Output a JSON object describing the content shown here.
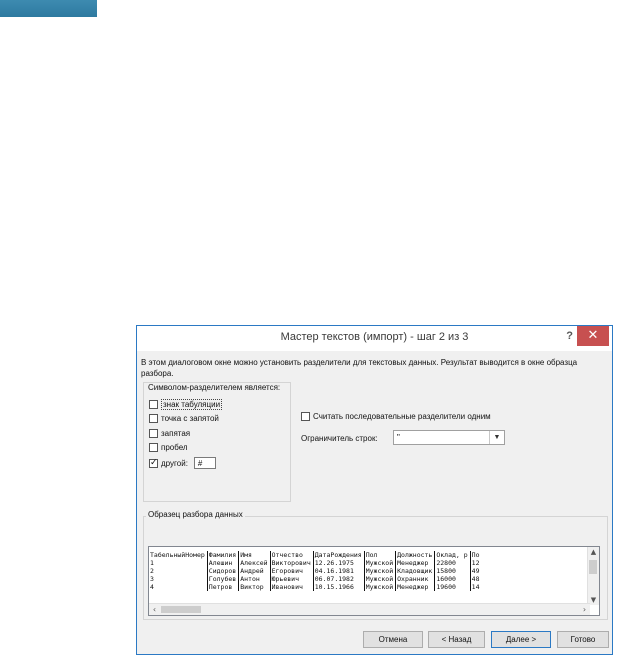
{
  "dialog": {
    "title": "Мастер текстов (импорт) - шаг 2 из 3",
    "help": "?",
    "close": "✕",
    "intro": "В этом диалоговом окне можно установить разделители для текстовых данных. Результат выводится в окне образца разбора."
  },
  "delimiters": {
    "group_title": "Символом-разделителем является:",
    "tab": {
      "label": "знак табуляции",
      "checked": false
    },
    "semicolon": {
      "label": "точка с запятой",
      "checked": false
    },
    "comma": {
      "label": "запятая",
      "checked": false
    },
    "space": {
      "label": "пробел",
      "checked": false
    },
    "other": {
      "label": "другой:",
      "checked": true,
      "value": "#"
    }
  },
  "options": {
    "consecutive_label": "Считать последовательные разделители одним",
    "consecutive_checked": false,
    "qualifier_label": "Ограничитель строк:",
    "qualifier_value": "\""
  },
  "preview": {
    "title": "Образец разбора данных",
    "rows": [
      [
        "ТабельныйНомер",
        "Фамилия",
        "Имя",
        "Отчество",
        "ДатаРождения",
        "Пол",
        "Должность",
        "Оклад, р",
        "По"
      ],
      [
        "1",
        "Алешин",
        "Алексей",
        "Викторович",
        "12.26.1975",
        "Мужской",
        "Менеджер",
        "22800",
        "12"
      ],
      [
        "2",
        "Сидоров",
        "Андрей",
        "Егорович",
        "04.16.1981",
        "Мужской",
        "Кладовщик",
        "15800",
        "49"
      ],
      [
        "3",
        "Голубев",
        "Антон",
        "Юрьевич",
        "06.07.1982",
        "Мужской",
        "Охранник",
        "16000",
        "48"
      ],
      [
        "4",
        "Петров",
        "Виктор",
        "Иванович",
        "10.15.1966",
        "Мужской",
        "Менеджер",
        "19600",
        "14"
      ]
    ]
  },
  "buttons": {
    "cancel": "Отмена",
    "back": "< Назад",
    "next": "Далее >",
    "finish": "Готово"
  },
  "colors": {
    "accent": "#2b79c4",
    "close_button": "#c75050",
    "top_bar": "#3586ab"
  }
}
